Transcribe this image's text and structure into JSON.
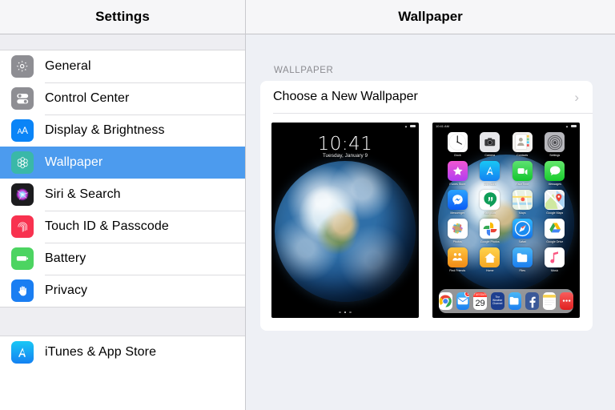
{
  "sidebar": {
    "title": "Settings",
    "groups": [
      {
        "items": [
          {
            "label": "General",
            "icon": "gear-icon",
            "selected": false
          },
          {
            "label": "Control Center",
            "icon": "sliders-icon",
            "selected": false
          },
          {
            "label": "Display & Brightness",
            "icon": "aa-text-icon",
            "selected": false
          },
          {
            "label": "Wallpaper",
            "icon": "flower-icon",
            "selected": true
          },
          {
            "label": "Siri & Search",
            "icon": "siri-icon",
            "selected": false
          },
          {
            "label": "Touch ID & Passcode",
            "icon": "fingerprint-icon",
            "selected": false
          },
          {
            "label": "Battery",
            "icon": "battery-icon",
            "selected": false
          },
          {
            "label": "Privacy",
            "icon": "hand-icon",
            "selected": false
          }
        ]
      },
      {
        "items": [
          {
            "label": "iTunes & App Store",
            "icon": "app-store-icon",
            "selected": false
          }
        ]
      }
    ]
  },
  "detail": {
    "title": "Wallpaper",
    "section_label": "WALLPAPER",
    "choose_row": {
      "label": "Choose a New Wallpaper",
      "chevron": "›"
    },
    "lock_preview": {
      "name": "lock-screen-preview",
      "time": "10:41",
      "date": "Tuesday, January 9",
      "page_dots": 3,
      "active_dot": 1
    },
    "home_preview": {
      "name": "home-screen-preview",
      "status_time": "10:41 AM",
      "apps": [
        {
          "label": "Clock",
          "icon": "clock-icon"
        },
        {
          "label": "Camera",
          "icon": "camera-icon"
        },
        {
          "label": "Contacts",
          "icon": "contacts-icon"
        },
        {
          "label": "Settings",
          "icon": "settings-icon"
        },
        {
          "label": "iTunes Store",
          "icon": "itunes-store-icon"
        },
        {
          "label": "App Store",
          "icon": "app-store-icon"
        },
        {
          "label": "FaceTime",
          "icon": "facetime-icon"
        },
        {
          "label": "Messages",
          "icon": "messages-icon"
        },
        {
          "label": "Messenger",
          "icon": "messenger-icon"
        },
        {
          "label": "Hangouts",
          "icon": "hangouts-icon"
        },
        {
          "label": "Maps",
          "icon": "maps-icon"
        },
        {
          "label": "Google Maps",
          "icon": "google-maps-icon"
        },
        {
          "label": "Photos",
          "icon": "photos-icon"
        },
        {
          "label": "Google Photos",
          "icon": "google-photos-icon"
        },
        {
          "label": "Safari",
          "icon": "safari-icon"
        },
        {
          "label": "Google Drive",
          "icon": "google-drive-icon"
        },
        {
          "label": "Find Friends",
          "icon": "find-friends-icon"
        },
        {
          "label": "Home",
          "icon": "home-icon"
        },
        {
          "label": "Files",
          "icon": "files-icon"
        },
        {
          "label": "Music",
          "icon": "music-icon"
        }
      ],
      "dock": [
        {
          "label": "Chrome",
          "icon": "chrome-icon",
          "badge": ""
        },
        {
          "label": "Mail",
          "icon": "mail-icon",
          "badge": "1"
        },
        {
          "label": "Calendar",
          "icon": "calendar-icon",
          "badge": "",
          "cal_month": "TUESDAY",
          "cal_day": "29"
        },
        {
          "label": "Weather Channel",
          "icon": "weather-icon",
          "badge": "",
          "text": "The Weather Channel"
        },
        {
          "label": "Files",
          "icon": "files-icon",
          "badge": ""
        },
        {
          "label": "Facebook",
          "icon": "facebook-icon",
          "badge": ""
        },
        {
          "label": "Notes",
          "icon": "notes-icon",
          "badge": ""
        },
        {
          "label": "More",
          "icon": "more-icon",
          "badge": ""
        }
      ]
    }
  },
  "colors": {
    "accent": "#4c9bee",
    "page_bg": "#eef0f5",
    "header_bg": "#f6f6f8",
    "card_bg": "#ffffff"
  }
}
